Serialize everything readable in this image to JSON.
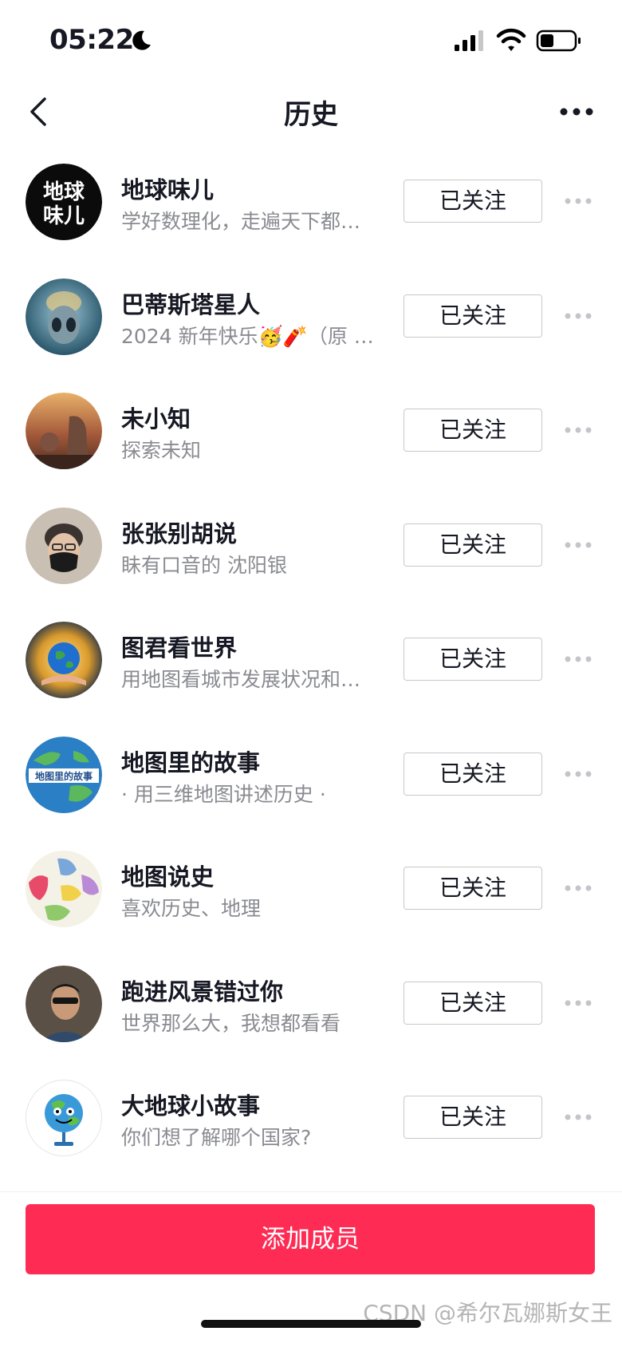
{
  "status_bar": {
    "time": "05:22"
  },
  "nav": {
    "title": "历史"
  },
  "users": [
    {
      "name": "地球味儿",
      "desc": "学好数理化，走遍天下都…",
      "button": "已关注",
      "avatar_text": "地球味儿"
    },
    {
      "name": "巴蒂斯塔星人",
      "desc": "2024 新年快乐🥳🧨（原 I…",
      "button": "已关注"
    },
    {
      "name": "未小知",
      "desc": "探索未知",
      "button": "已关注"
    },
    {
      "name": "张张别胡说",
      "desc": "眛有口音的 沈阳银",
      "button": "已关注"
    },
    {
      "name": "图君看世界",
      "desc": "用地图看城市发展状况和…",
      "button": "已关注"
    },
    {
      "name": "地图里的故事",
      "desc": "· 用三维地图讲述历史 ·",
      "button": "已关注",
      "avatar_text": "地图里的故事"
    },
    {
      "name": "地图说史",
      "desc": "喜欢历史、地理",
      "button": "已关注"
    },
    {
      "name": "跑进风景错过你",
      "desc": "世界那么大，我想都看看",
      "button": "已关注"
    },
    {
      "name": "大地球小故事",
      "desc": "你们想了解哪个国家?",
      "button": "已关注"
    }
  ],
  "footer": {
    "add_button": "添加成员"
  },
  "watermark": "CSDN @希尔瓦娜斯女王",
  "colors": {
    "accent": "#fe2c55",
    "secondary_text": "#8a8b91"
  }
}
